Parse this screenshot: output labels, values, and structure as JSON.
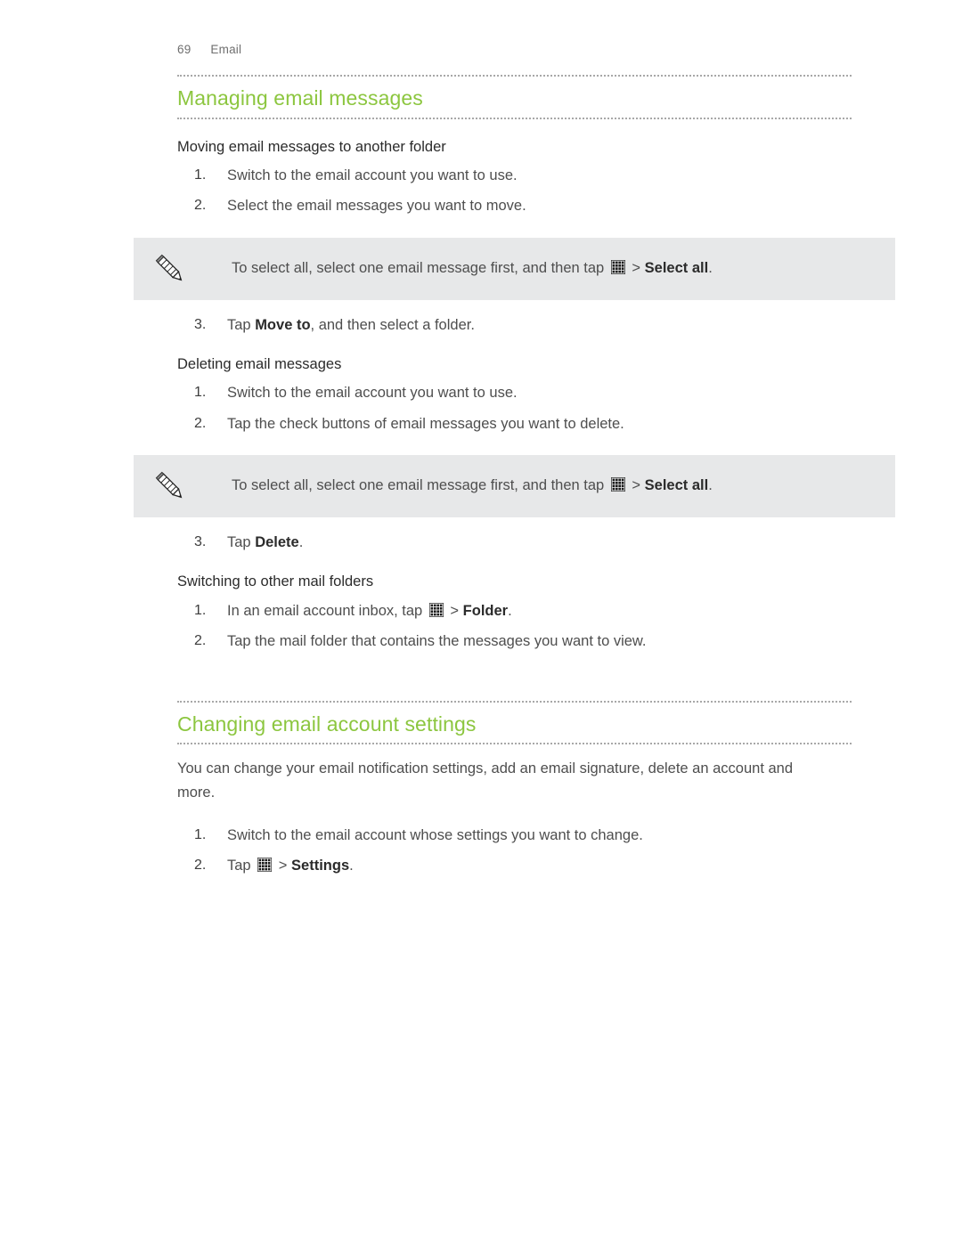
{
  "header": {
    "page_number": "69",
    "section": "Email"
  },
  "colors": {
    "heading_green": "#8CC63F",
    "body_text": "#4E4E4E",
    "note_background": "#E7E8E9",
    "rule_dotted": "#9A9A9A"
  },
  "icons": {
    "grid_menu": "grid-menu-icon",
    "note_pencil": "pencil-icon",
    "chevron": ">"
  },
  "sections": [
    {
      "id": "managing-email-messages",
      "heading": "Managing email messages",
      "subsections": [
        {
          "id": "moving-email-messages-to-another-folder",
          "title": "Moving email messages to another folder",
          "steps_before_note": [
            {
              "num": "1.",
              "text": "Switch to the email account you want to use."
            },
            {
              "num": "2.",
              "text": "Select the email messages you want to move."
            }
          ],
          "note": {
            "icon": "pencil-icon",
            "text_before_icon": "To select all, select one email message first, and then tap",
            "icon_inline": "grid-menu-icon",
            "chevron": ">",
            "text_after_icon_bold": "Select all",
            "text_tail": "."
          },
          "steps_after_note": [
            {
              "num": "3.",
              "text_before_bold": "Tap ",
              "bold": "Move to",
              "text_after_bold": ", and then select a folder."
            }
          ]
        },
        {
          "id": "deleting-email-messages",
          "title": "Deleting email messages",
          "steps_before_note": [
            {
              "num": "1.",
              "text": "Switch to the email account you want to use."
            },
            {
              "num": "2.",
              "text": "Tap the check buttons of email messages you want to delete."
            }
          ],
          "note": {
            "icon": "pencil-icon",
            "text_before_icon": "To select all, select one email message first, and then tap",
            "icon_inline": "grid-menu-icon",
            "chevron": ">",
            "text_after_icon_bold": "Select all",
            "text_tail": "."
          },
          "steps_after_note": [
            {
              "num": "3.",
              "text_before_bold": "Tap ",
              "bold": "Delete",
              "text_after_bold": "."
            }
          ]
        },
        {
          "id": "switching-to-other-mail-folders",
          "title": "Switching to other mail folders",
          "steps": [
            {
              "num": "1.",
              "text_before_icon": "In an email account inbox, tap",
              "icon_inline": "grid-menu-icon",
              "chevron": ">",
              "bold": "Folder",
              "text_tail": "."
            },
            {
              "num": "2.",
              "text": "Tap the mail folder that contains the messages you want to view."
            }
          ]
        }
      ]
    },
    {
      "id": "changing-email-account-settings",
      "heading": "Changing email account settings",
      "paragraph": "You can change your email notification settings, add an email signature, delete an account and more.",
      "steps": [
        {
          "num": "1.",
          "text": "Switch to the email account whose settings you want to change."
        },
        {
          "num": "2.",
          "text_before_icon": "Tap",
          "icon_inline": "grid-menu-icon",
          "chevron": ">",
          "bold": "Settings",
          "text_tail": "."
        }
      ]
    }
  ]
}
